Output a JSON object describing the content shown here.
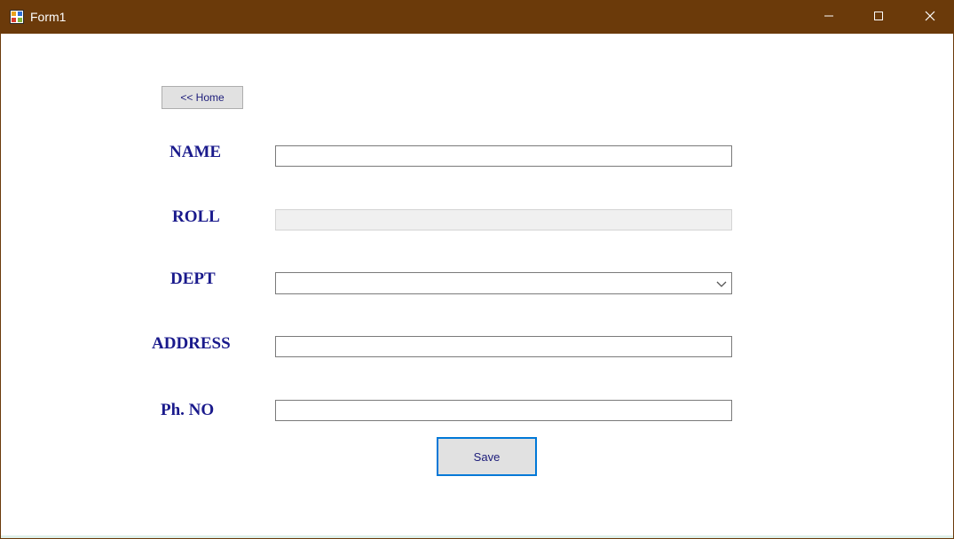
{
  "window": {
    "title": "Form1",
    "icon": "form-app-icon",
    "controls": [
      "minimize-icon",
      "maximize-icon",
      "close-icon"
    ]
  },
  "form": {
    "home_button": "<< Home",
    "labels": {
      "name": "NAME",
      "roll": "ROLL",
      "dept": "DEPT",
      "address": "ADDRESS",
      "phone": "Ph. NO"
    },
    "fields": {
      "name": "",
      "roll": "",
      "dept": "",
      "address": "",
      "phone": ""
    },
    "save_button": "Save"
  },
  "colors": {
    "titlebar": "#6b3a0a",
    "label_text": "#1a1a8c",
    "focus_border": "#0078d7"
  }
}
